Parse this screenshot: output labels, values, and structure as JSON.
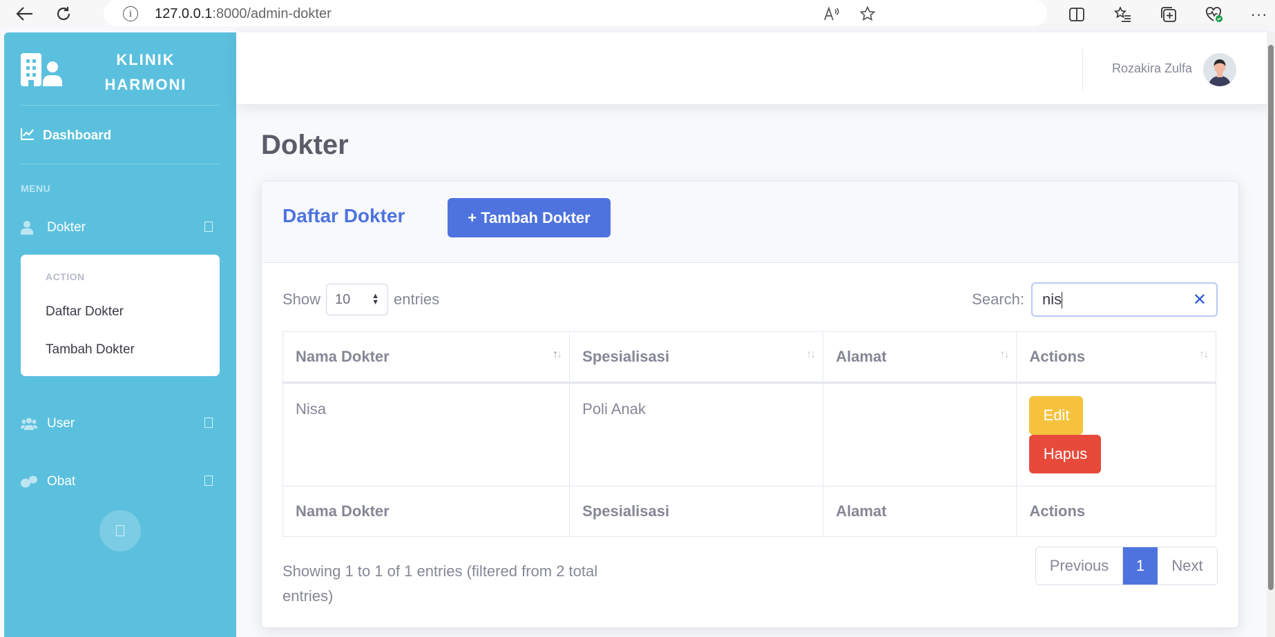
{
  "browser": {
    "url_host": "127.0.0.1",
    "url_path": ":8000/admin-dokter",
    "info_icon": "i"
  },
  "sidebar": {
    "brand_line1": "KLINIK",
    "brand_line2": "HARMONI",
    "dashboard": "Dashboard",
    "menu_heading": "MENU",
    "items": [
      {
        "label": "Dokter",
        "icon": "user-icon"
      },
      {
        "label": "User",
        "icon": "users-icon"
      },
      {
        "label": "Obat",
        "icon": "pills-icon"
      }
    ],
    "collapse": {
      "heading": "ACTION",
      "links": [
        "Daftar Dokter",
        "Tambah Dokter"
      ]
    },
    "colors": {
      "background": "#5bc0de"
    }
  },
  "topbar": {
    "username": "Rozakira Zulfa"
  },
  "page": {
    "title": "Dokter"
  },
  "card": {
    "title": "Daftar Dokter",
    "add_button": "+ Tambah Dokter",
    "show_label": "Show",
    "entries_value": "10",
    "entries_label": "entries",
    "search_label": "Search:",
    "search_value": "nis",
    "table": {
      "columns": [
        "Nama Dokter",
        "Spesialisasi",
        "Alamat",
        "Actions"
      ],
      "rows": [
        {
          "nama": "Nisa",
          "spesialisasi": "Poli Anak",
          "alamat": "",
          "edit": "Edit",
          "hapus": "Hapus"
        }
      ]
    },
    "info": "Showing 1 to 1 of 1 entries (filtered from 2 total entries)",
    "pagination": {
      "previous": "Previous",
      "current": "1",
      "next": "Next"
    }
  },
  "colors": {
    "primary": "#4e73df",
    "warning": "#f6c23e",
    "danger": "#e74a3b"
  }
}
